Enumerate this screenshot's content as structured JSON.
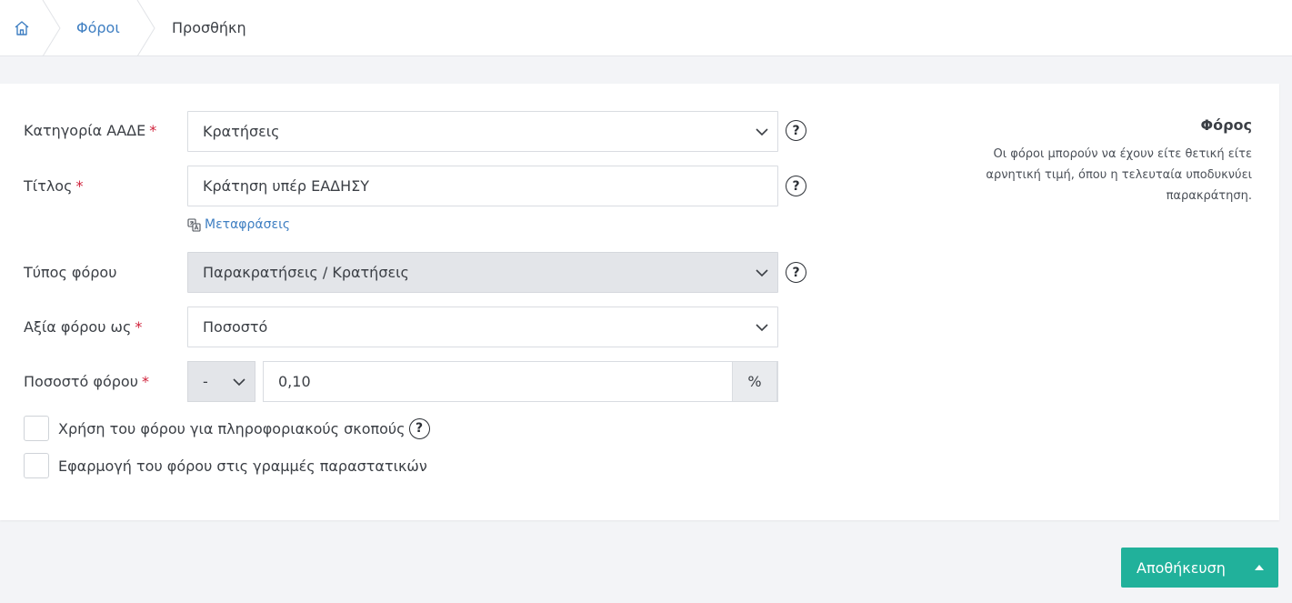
{
  "breadcrumb": {
    "items": [
      "Φόροι",
      "Προσθήκη"
    ]
  },
  "form": {
    "category": {
      "label": "Κατηγορία ΑΑΔΕ",
      "value": "Κρατήσεις"
    },
    "title": {
      "label": "Τίτλος",
      "value": "Κράτηση υπέρ ΕΑΔΗΣΥ"
    },
    "translations_link": "Μεταφράσεις",
    "tax_type": {
      "label": "Τύπος φόρου",
      "value": "Παρακρατήσεις / Κρατήσεις"
    },
    "value_as": {
      "label": "Αξία φόρου ως",
      "value": "Ποσοστό"
    },
    "percentage": {
      "label": "Ποσοστό φόρου",
      "sign": "-",
      "value": "0,10",
      "unit": "%"
    },
    "informational_checkbox": {
      "label": "Χρήση του φόρου για πληροφοριακούς σκοπούς",
      "checked": false
    },
    "apply_lines_checkbox": {
      "label": "Εφαρμογή του φόρου στις γραμμές παραστατικών",
      "checked": false
    },
    "required_mark": "*",
    "help_mark": "?"
  },
  "info": {
    "title": "Φόρος",
    "text": "Οι φόροι μπορούν να έχουν είτε θετική είτε αρνητική τιμή, όπου η τελευταία υποδυκνύει παρακράτηση."
  },
  "actions": {
    "save_label": "Αποθήκευση"
  },
  "colors": {
    "accent": "#21b19b",
    "link": "#3f7fc2",
    "required": "#d0223b"
  },
  "icons": [
    "home-icon",
    "chevron-down-icon",
    "help-icon",
    "translate-icon",
    "caret-up-icon"
  ]
}
